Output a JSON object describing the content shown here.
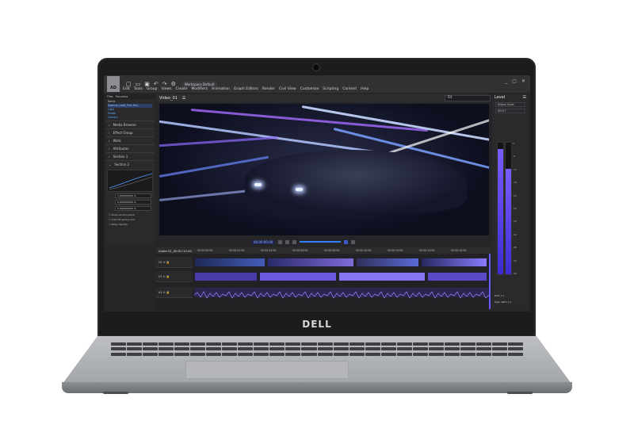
{
  "app": {
    "logo_text": "AD",
    "workspace": "Workspace Default",
    "menus": [
      "Edit",
      "Tools",
      "Group",
      "Views",
      "Create",
      "Modifiers",
      "Animation",
      "Graph Editors",
      "Render",
      "Civil View",
      "Customize",
      "Scripting",
      "Content",
      "Help"
    ],
    "window_controls": [
      "_",
      "▢",
      "✕"
    ]
  },
  "left_panel": {
    "tabs": [
      "Files",
      "Favorites"
    ],
    "tree_items": [
      "Name",
      "Daphne_Leslit_Trim Hrd...",
      "Light",
      "Shade",
      "Camera"
    ],
    "sections": [
      "Media Browser",
      "Effect Group",
      "Work",
      "Attributes",
      "Section 1",
      "Section 2"
    ],
    "fields": [
      "1.000000000 m",
      "0.000000000 m",
      "0.000000000 m"
    ],
    "checkboxes": [
      "Show section plane",
      "Auto Fit section box",
      "Relay tips file"
    ]
  },
  "viewer": {
    "title": "Video_01",
    "zoom": "Fit",
    "timecode": "00:00:00:00"
  },
  "timeline": {
    "label": "Audio 01_00:00:10:40",
    "times": [
      "00:00:00:00",
      "00:00:02:00",
      "00:00:04:00",
      "00:00:06:00",
      "00:00:08:00",
      "00:00:10:00",
      "00:00:12:00",
      "00:00:14:00",
      "00:00:16:00"
    ],
    "tracks": [
      "V2",
      "V1",
      "A1"
    ]
  },
  "right_panel": {
    "title": "Level",
    "field1": "Digital Scale",
    "field2": "AES17",
    "scale": [
      "0",
      "-6",
      "-12",
      "-18",
      "-24",
      "-30",
      "-36",
      "-42",
      "-48",
      "-54",
      "-60"
    ],
    "meter_left": 0.95,
    "meter_right": 0.8,
    "peak_label": "RMS 1.0",
    "peak_label2": "Peak dBFS 1.5"
  },
  "brand": {
    "name": "DELL",
    "accent": "#6a5cff",
    "trail_colors": [
      "#b0c6ff",
      "#a56bff",
      "#7aa0ff",
      "#ffffff"
    ]
  }
}
